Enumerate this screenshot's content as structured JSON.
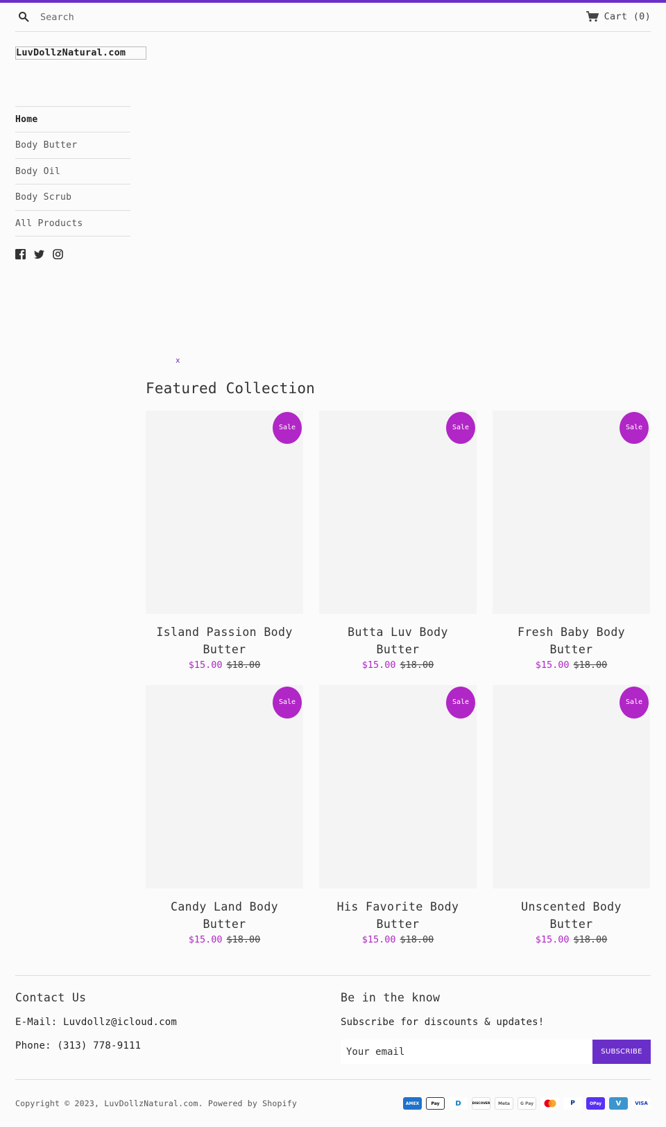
{
  "header": {
    "search_placeholder": "Search",
    "cart_label": "Cart (0)"
  },
  "site": {
    "logo": "LuvDollzNatural.com"
  },
  "nav": {
    "items": [
      {
        "label": "Home"
      },
      {
        "label": "Body Butter"
      },
      {
        "label": "Body Oil"
      },
      {
        "label": "Body Scrub"
      },
      {
        "label": "All Products"
      }
    ]
  },
  "social": [
    "facebook-icon",
    "twitter-icon",
    "instagram-icon"
  ],
  "hero": {
    "broken_image_text": "x"
  },
  "featured": {
    "title": "Featured Collection",
    "badge": "Sale",
    "products": [
      {
        "title": "Island Passion Body Butter",
        "sale_price": "$15.00",
        "original_price": "$18.00"
      },
      {
        "title": "Butta Luv Body Butter",
        "sale_price": "$15.00",
        "original_price": "$18.00"
      },
      {
        "title": "Fresh Baby Body Butter",
        "sale_price": "$15.00",
        "original_price": "$18.00"
      },
      {
        "title": "Candy Land Body Butter",
        "sale_price": "$15.00",
        "original_price": "$18.00"
      },
      {
        "title": "His Favorite Body Butter",
        "sale_price": "$15.00",
        "original_price": "$18.00"
      },
      {
        "title": "Unscented Body Butter",
        "sale_price": "$15.00",
        "original_price": "$18.00"
      }
    ]
  },
  "footer": {
    "contact_title": "Contact Us",
    "email_line": "E-Mail: Luvdollz@icloud.com",
    "phone_line": "Phone: (313) 778-9111",
    "newsletter_title": "Be in the know",
    "newsletter_text": "Subscribe for discounts & updates!",
    "email_placeholder": "Your email",
    "subscribe_label": "SUBSCRIBE",
    "copyright": "Copyright © 2023, LuvDollzNatural.com. Powered by Shopify"
  },
  "payments": [
    {
      "name": "american-express-icon",
      "label": "AMEX"
    },
    {
      "name": "apple-pay-icon",
      "label": "Pay"
    },
    {
      "name": "diners-club-icon",
      "label": "D"
    },
    {
      "name": "discover-icon",
      "label": "DISCOVER"
    },
    {
      "name": "meta-pay-icon",
      "label": "Meta"
    },
    {
      "name": "google-pay-icon",
      "label": "G Pay"
    },
    {
      "name": "mastercard-icon",
      "label": ""
    },
    {
      "name": "paypal-icon",
      "label": "P"
    },
    {
      "name": "shop-pay-icon",
      "label": "OPay"
    },
    {
      "name": "venmo-icon",
      "label": "V"
    },
    {
      "name": "visa-icon",
      "label": "VISA"
    }
  ],
  "colors": {
    "accent": "#6b2fc9",
    "sale": "#b126c6"
  }
}
